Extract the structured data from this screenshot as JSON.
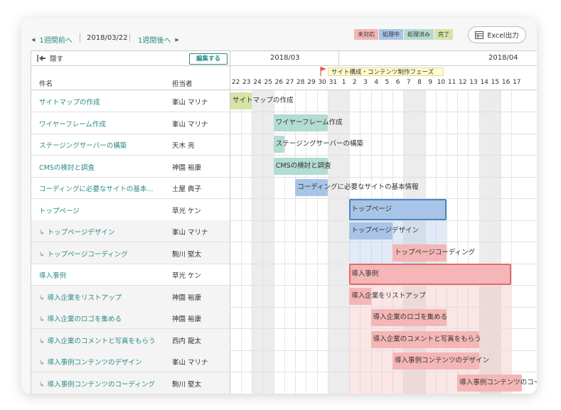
{
  "toolbar": {
    "prev_label": "1週間前へ",
    "current_date": "2018/03/22",
    "next_label": "1週間後へ",
    "excel_label": "Excel出力"
  },
  "legend": [
    {
      "label": "未対応",
      "color": "#f4b6b6"
    },
    {
      "label": "処理中",
      "color": "#a8c4e6"
    },
    {
      "label": "処理済み",
      "color": "#b3dcd2"
    },
    {
      "label": "完了",
      "color": "#d6e4a8"
    }
  ],
  "grid": {
    "hide_label": "隠す",
    "edit_label": "編集する",
    "col_name": "件名",
    "col_assignee": "担当者",
    "month_left": "2018/03",
    "month_right": "2018/04",
    "phase_label": "サイト構成・コンテンツ制作フェーズ",
    "days": [
      "22",
      "23",
      "24",
      "25",
      "26",
      "27",
      "28",
      "29",
      "30",
      "31",
      "1",
      "2",
      "3",
      "4",
      "5",
      "6",
      "7",
      "8",
      "9",
      "10",
      "11",
      "12",
      "13",
      "14",
      "15",
      "16",
      "17"
    ],
    "weekend_indices": [
      2,
      3,
      9,
      10,
      16,
      17,
      23,
      24
    ]
  },
  "tasks": [
    {
      "name": "サイトマップの作成",
      "assignee": "峯山 マリナ",
      "sub": false,
      "start": 0,
      "end": 2,
      "status": "done",
      "bar_label": "サイトマップの作成"
    },
    {
      "name": "ワイヤーフレーム作成",
      "assignee": "峯山 マリナ",
      "sub": false,
      "start": 4,
      "end": 9,
      "status": "resolved",
      "bar_label": "ワイヤーフレーム作成"
    },
    {
      "name": "ステージングサーバーの構築",
      "assignee": "天木 亮",
      "sub": false,
      "start": 4,
      "end": 5,
      "status": "resolved",
      "bar_label": "ステージングサーバーの構築"
    },
    {
      "name": "CMSの検討と調査",
      "assignee": "神園 裕康",
      "sub": false,
      "start": 4,
      "end": 9,
      "status": "resolved",
      "bar_label": "CMSの検討と調査"
    },
    {
      "name": "コーディングに必要なサイトの基本...",
      "assignee": "土屋 典子",
      "sub": false,
      "start": 6,
      "end": 9,
      "status": "progress",
      "bar_label": "コーディングに必要なサイトの基本情報"
    },
    {
      "name": "トップページ",
      "assignee": "草光 ケン",
      "sub": false,
      "start": 11,
      "end": 20,
      "status": "progress",
      "bar_label": "トップページ",
      "parent": true
    },
    {
      "name": "トップページデザイン",
      "assignee": "峯山 マリナ",
      "sub": true,
      "start": 11,
      "end": 15,
      "status": "progress",
      "bar_label": "トップページデザイン"
    },
    {
      "name": "トップページコーディング",
      "assignee": "駒川 堅太",
      "sub": true,
      "start": 15,
      "end": 20,
      "status": "open",
      "bar_label": "トップページコーディング"
    },
    {
      "name": "導入事例",
      "assignee": "草光 ケン",
      "sub": false,
      "start": 11,
      "end": 26,
      "status": "open",
      "bar_label": "導入事例",
      "parent": true
    },
    {
      "name": "導入企業をリストアップ",
      "assignee": "神園 裕康",
      "sub": true,
      "start": 11,
      "end": 13,
      "status": "open",
      "bar_label": "導入企業をリストアップ"
    },
    {
      "name": "導入企業のロゴを集める",
      "assignee": "神園 裕康",
      "sub": true,
      "start": 13,
      "end": 20,
      "status": "open",
      "bar_label": "導入企業のロゴを集める"
    },
    {
      "name": "導入企業のコメントと写真をもらう",
      "assignee": "西内 龍太",
      "sub": true,
      "start": 13,
      "end": 23,
      "status": "open",
      "bar_label": "導入企業のコメントと写真をもらう"
    },
    {
      "name": "導入事例コンテンツのデザイン",
      "assignee": "峯山 マリナ",
      "sub": true,
      "start": 15,
      "end": 23,
      "status": "open",
      "bar_label": "導入事例コンテンツのデザイン"
    },
    {
      "name": "導入事例コンテンツのコーディング",
      "assignee": "駒川 堅太",
      "sub": true,
      "start": 21,
      "end": 27,
      "status": "open",
      "bar_label": "導入事例コンテンツのコーディング"
    }
  ]
}
